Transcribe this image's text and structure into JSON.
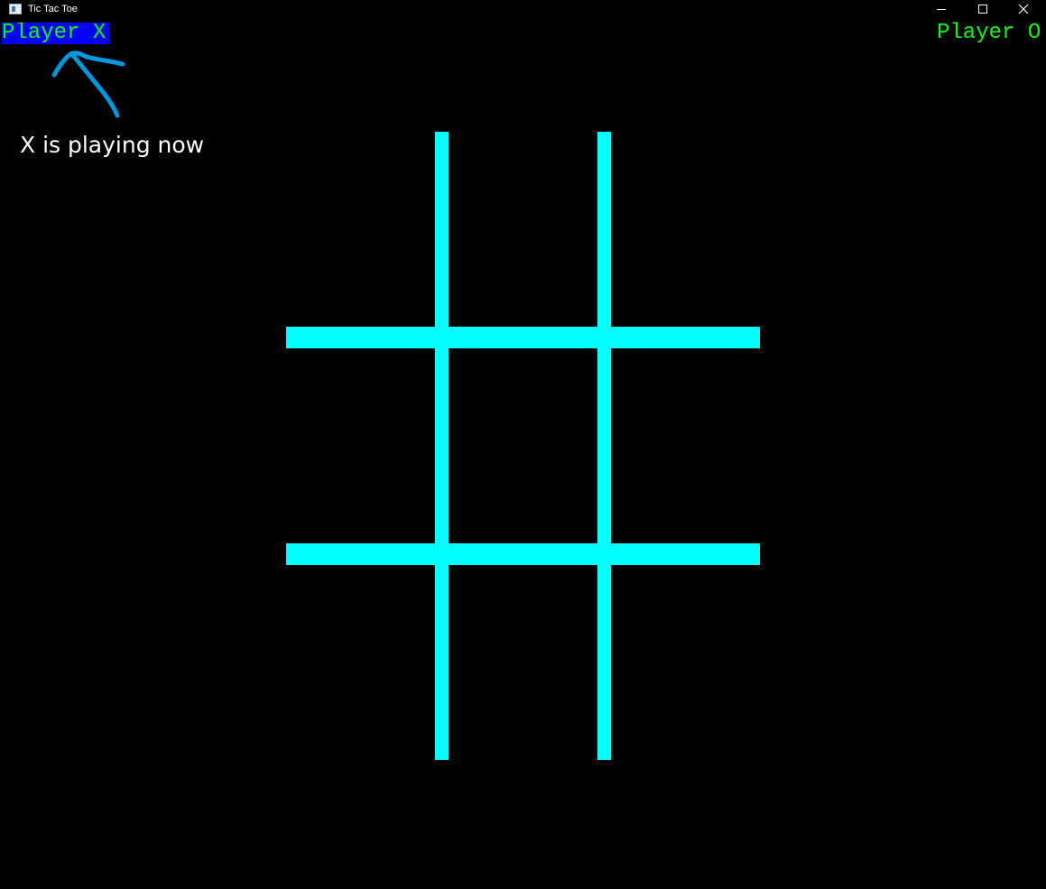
{
  "window": {
    "title": "Tic Tac Toe",
    "icon": "app-window-icon",
    "controls": [
      "minimize-icon",
      "maximize-icon",
      "close-icon"
    ]
  },
  "players": {
    "x_label": "Player X",
    "o_label": "Player O",
    "active": "X"
  },
  "annotation": {
    "text": "X is playing now",
    "arrow_icon": "hand-drawn-arrow-icon"
  },
  "board": {
    "cells": [
      "",
      "",
      "",
      "",
      "",
      "",
      "",
      "",
      ""
    ]
  },
  "colors": {
    "background": "#000000",
    "grid": "#00ffff",
    "player_text": "#00ff00",
    "active_highlight": "#0000ff",
    "annotation_arrow": "#0098e0",
    "annotation_text": "#ffffff"
  }
}
